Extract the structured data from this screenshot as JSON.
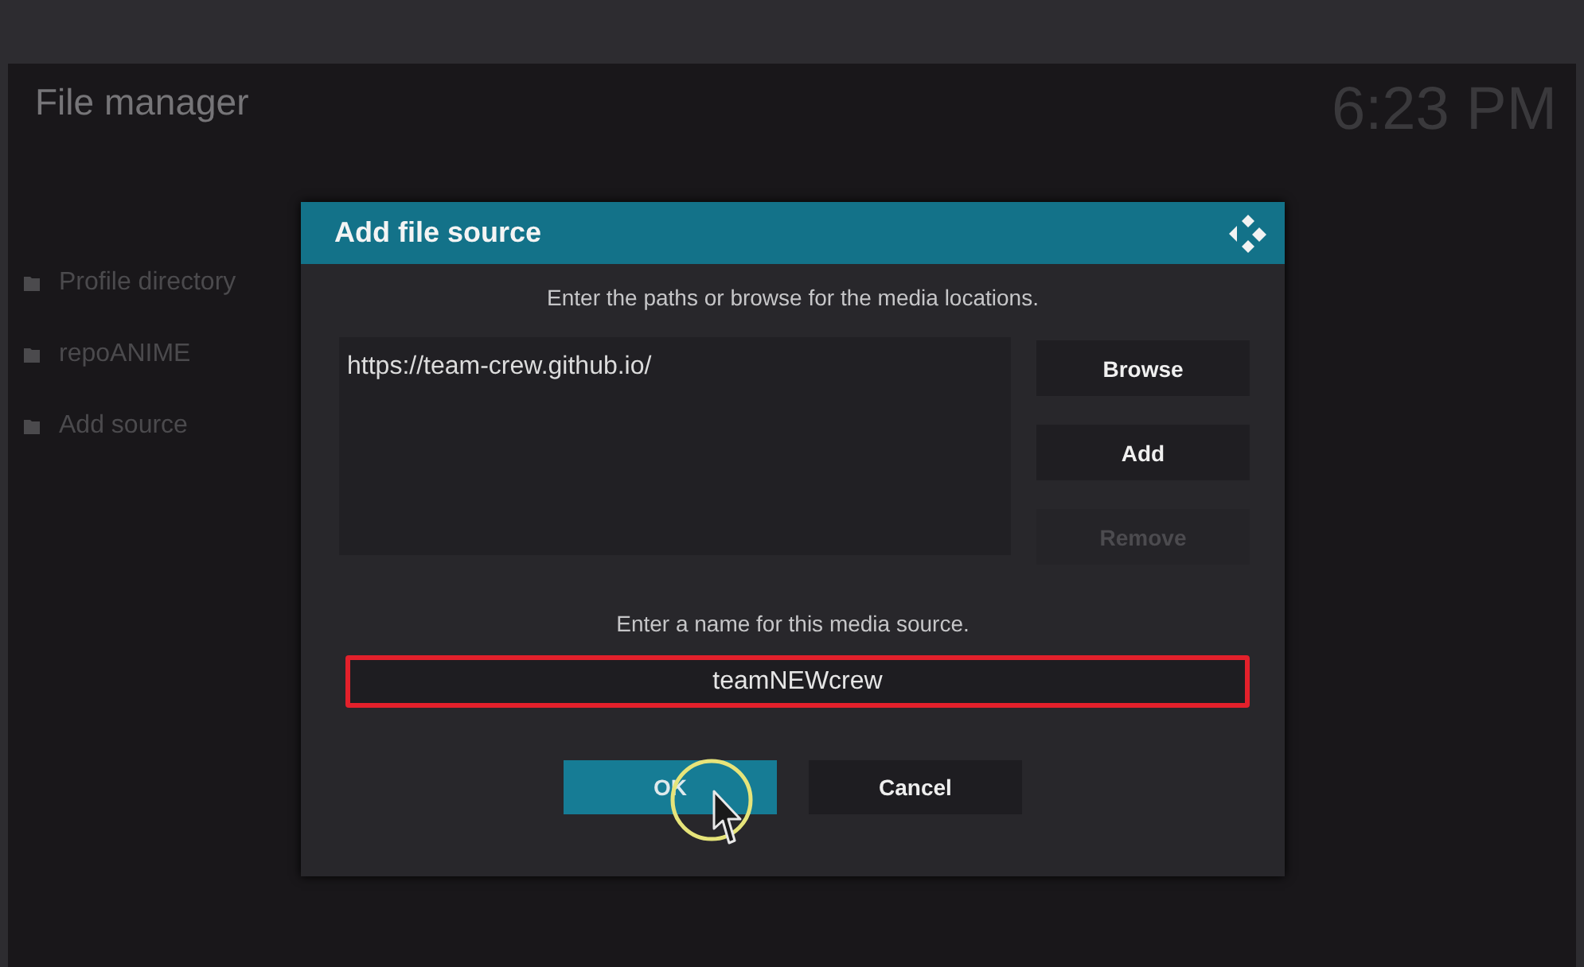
{
  "header": {
    "title": "File manager",
    "clock": "6:23 PM"
  },
  "sources": [
    {
      "label": "Profile directory"
    },
    {
      "label": "repoANIME"
    },
    {
      "label": "Add source"
    }
  ],
  "dialog": {
    "title": "Add file source",
    "paths_prompt": "Enter the paths or browse for the media locations.",
    "paths": [
      "https://team-crew.github.io/"
    ],
    "side_buttons": [
      {
        "label": "Browse",
        "disabled": false
      },
      {
        "label": "Add",
        "disabled": false
      },
      {
        "label": "Remove",
        "disabled": true
      }
    ],
    "name_prompt": "Enter a name for this media source.",
    "name_value": "teamNEWcrew",
    "buttons": [
      {
        "label": "OK",
        "selected": true
      },
      {
        "label": "Cancel",
        "selected": false
      }
    ]
  }
}
